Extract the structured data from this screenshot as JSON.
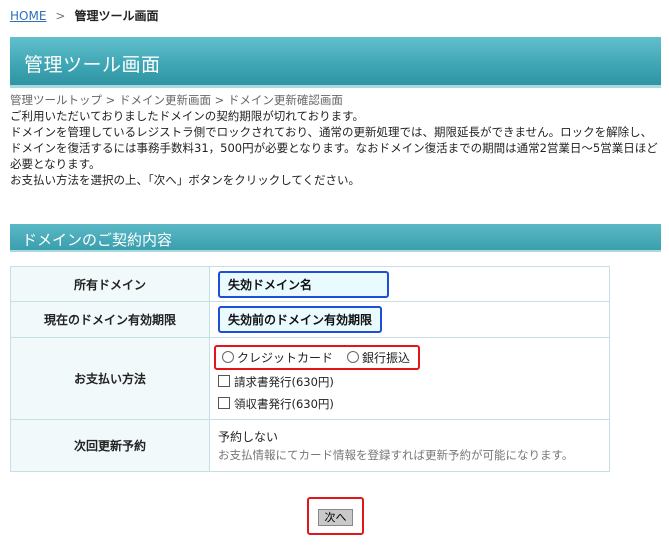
{
  "breadcrumb": {
    "home": "HOME",
    "separator": ">",
    "current": "管理ツール画面"
  },
  "page_title": "管理ツール画面",
  "sub_breadcrumb": "管理ツールトップ > ドメイン更新画面 > ドメイン更新確認画面",
  "intro": {
    "line1": "ご利用いただいておりましたドメインの契約期限が切れております。",
    "line2": "ドメインを管理しているレジストラ側でロックされており、通常の更新処理では、期限延長ができません。ロックを解除し、ドメインを復活するには事務手数料31，500円が必要となります。なおドメイン復活までの期間は通常2営業日〜5営業日ほど必要となります。",
    "line3": "お支払い方法を選択の上、「次へ」ボタンをクリックしてください。"
  },
  "section_title": "ドメインのご契約内容",
  "table": {
    "domain_label": "所有ドメイン",
    "domain_value": "失効ドメイン名",
    "expiry_label": "現在のドメイン有効期限",
    "expiry_value": "失効前のドメイン有効期限",
    "payment_label": "お支払い方法",
    "payment_options": [
      "クレジットカード",
      "銀行振込"
    ],
    "invoice_option": "請求書発行(630円)",
    "receipt_option": "領収書発行(630円)",
    "renewal_label": "次回更新予約",
    "renewal_value": "予約しない",
    "renewal_note_link": "お支払情報",
    "renewal_note_rest": "にてカード情報を登録すれば更新予約が可能になります。"
  },
  "next_button": "次へ"
}
